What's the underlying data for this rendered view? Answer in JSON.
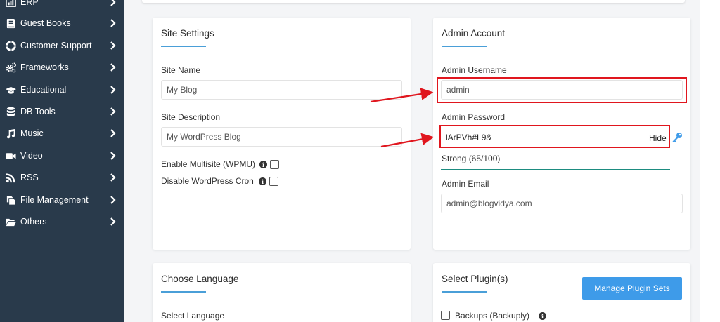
{
  "sidebar": {
    "items": [
      {
        "label": "ERP",
        "icon": "chart-icon"
      },
      {
        "label": "Guest Books",
        "icon": "book-icon"
      },
      {
        "label": "Customer Support",
        "icon": "lifebuoy-icon"
      },
      {
        "label": "Frameworks",
        "icon": "gears-icon"
      },
      {
        "label": "Educational",
        "icon": "graduation-cap-icon"
      },
      {
        "label": "DB Tools",
        "icon": "database-icon"
      },
      {
        "label": "Music",
        "icon": "music-icon"
      },
      {
        "label": "Video",
        "icon": "video-icon"
      },
      {
        "label": "RSS",
        "icon": "rss-icon"
      },
      {
        "label": "File Management",
        "icon": "files-icon"
      },
      {
        "label": "Others",
        "icon": "folder-open-icon"
      }
    ]
  },
  "site_settings": {
    "title": "Site Settings",
    "site_name_label": "Site Name",
    "site_name_value": "My Blog",
    "site_desc_label": "Site Description",
    "site_desc_value": "My WordPress Blog",
    "multisite_label": "Enable Multisite (WPMU)",
    "cron_label": "Disable WordPress Cron"
  },
  "admin_account": {
    "title": "Admin Account",
    "username_label": "Admin Username",
    "username_value": "admin",
    "password_label": "Admin Password",
    "password_value": "lArPVh#L9&",
    "hide_label": "Hide",
    "strength_text": "Strong (65/100)",
    "email_label": "Admin Email",
    "email_value": "admin@blogvidya.com"
  },
  "choose_language": {
    "title": "Choose Language",
    "select_label": "Select Language"
  },
  "select_plugins": {
    "title": "Select Plugin(s)",
    "manage_button": "Manage Plugin Sets",
    "plugin_1": "Backups (Backuply)"
  },
  "colors": {
    "sidebar_bg": "#293a4b",
    "accent": "#3e9be9",
    "highlight_red": "#e0161e",
    "strength_bar": "#1d8c80"
  }
}
